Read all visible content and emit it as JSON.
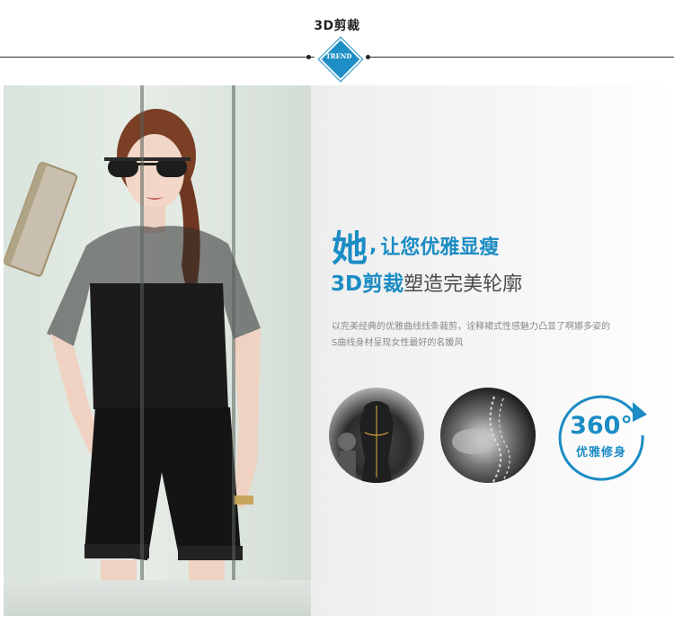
{
  "header": {
    "title": "3D剪裁",
    "badge": "TREND"
  },
  "headline": {
    "big_char": "她",
    "comma": ",",
    "rest": "让您优雅显瘦"
  },
  "subheadline": {
    "blue": "3D剪裁",
    "grey": "塑造完美轮廓"
  },
  "description": {
    "line1": "以完美经典的优雅曲线线条裁剪，诠释裙式性感魅力凸显了啊娜多姿的",
    "line2": "S曲线身材呈现女性最好的名媛风"
  },
  "feature": {
    "degrees": "360°",
    "label": "优雅修身"
  },
  "colors": {
    "accent": "#1b8cc4",
    "text_grey": "#4a4a4a",
    "desc_grey": "#8a8a8a"
  },
  "icons": [
    "trend-badge-icon",
    "rotate-arrow-icon"
  ]
}
